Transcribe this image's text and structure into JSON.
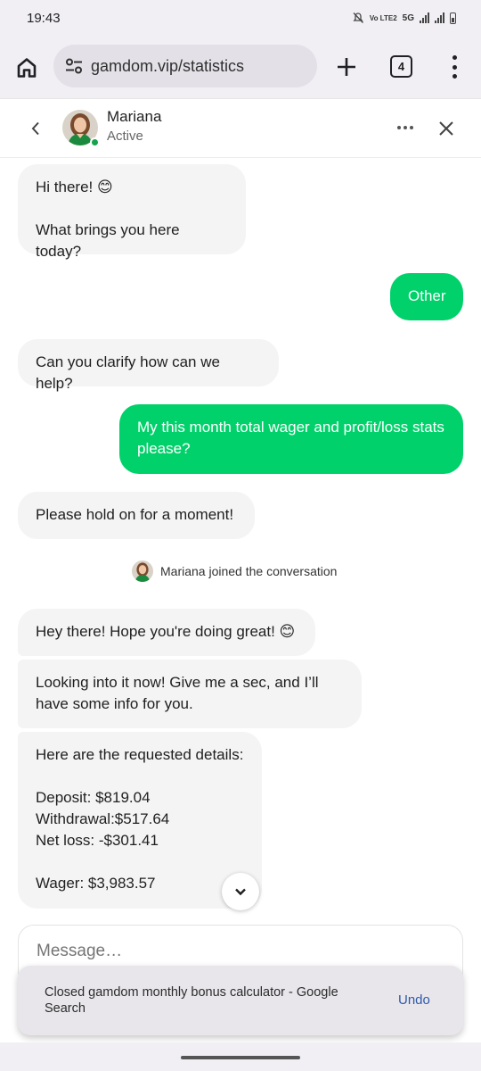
{
  "status_bar": {
    "time": "19:43",
    "network_label": "Vo LTE2",
    "network_type": "5G"
  },
  "browser": {
    "url": "gamdom.vip/statistics",
    "tab_count": "4"
  },
  "chat": {
    "agent_name": "Mariana",
    "agent_status": "Active",
    "messages": [
      {
        "from": "agent",
        "text": "Hi there! 😊\n\nWhat brings you here today?"
      },
      {
        "from": "user",
        "text": "Other"
      },
      {
        "from": "agent",
        "text": "Can you clarify how can we help?"
      },
      {
        "from": "user",
        "text": "My this month total wager and profit/loss stats please?"
      },
      {
        "from": "agent",
        "text": "Please hold on for a moment!"
      },
      {
        "from": "agent",
        "text": "Hey there! Hope you're doing great! 😊"
      },
      {
        "from": "agent",
        "text": "Looking into it now! Give me a sec, and I’ll have some info for you."
      },
      {
        "from": "agent",
        "text": "Here are the requested details:\n\nDeposit: $819.04\nWithdrawal:$517.64\nNet loss: -$301.41\n\nWager: $3,983.57"
      }
    ],
    "system_message": "Mariana joined the conversation",
    "composer_placeholder": "Message…"
  },
  "snackbar": {
    "text": "Closed gamdom monthly bonus calculator - Google Search",
    "action_label": "Undo"
  },
  "colors": {
    "user_bubble": "#00d16a",
    "agent_bubble": "#f4f4f4",
    "online_indicator": "#16a34a",
    "snackbar_action": "#2e5aa8"
  }
}
